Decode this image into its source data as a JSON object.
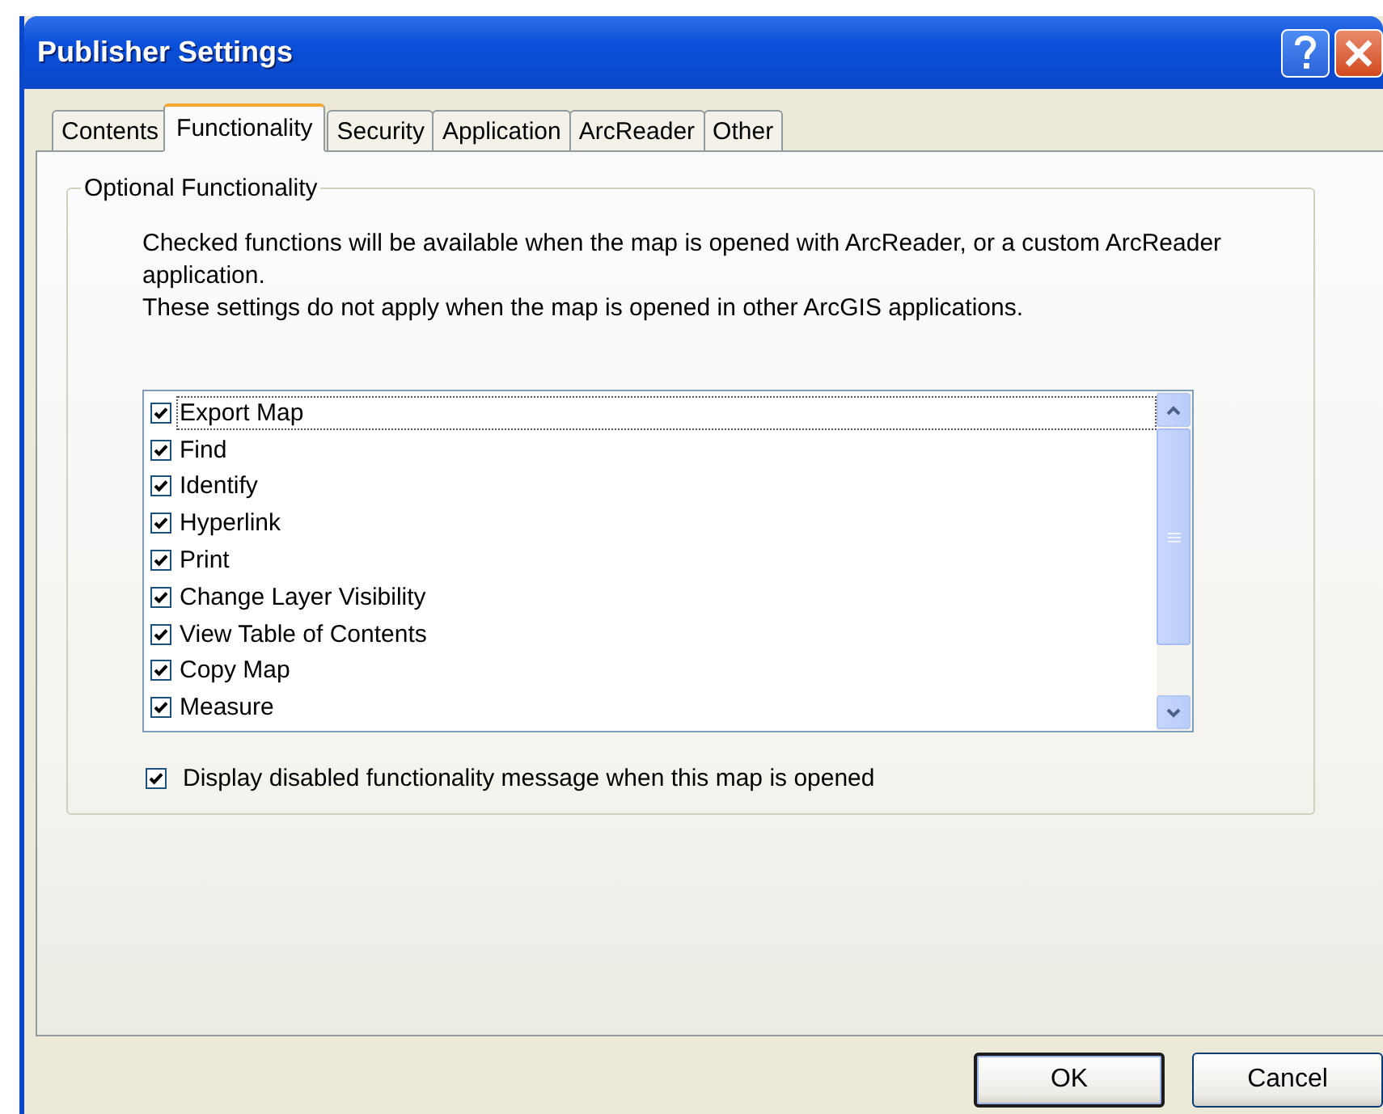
{
  "window": {
    "title": "Publisher Settings"
  },
  "tabs": [
    {
      "label": "Contents",
      "selected": false
    },
    {
      "label": "Functionality",
      "selected": true
    },
    {
      "label": "Security",
      "selected": false
    },
    {
      "label": "Application",
      "selected": false
    },
    {
      "label": "ArcReader",
      "selected": false
    },
    {
      "label": "Other",
      "selected": false
    }
  ],
  "group": {
    "title": "Optional Functionality",
    "description": [
      "Checked functions will be available when the map is opened with ArcReader, or a custom ArcReader application.",
      "These settings do not apply when the map is opened in other ArcGIS applications."
    ],
    "functions": [
      {
        "label": "Export Map",
        "checked": true,
        "focused": true
      },
      {
        "label": "Find",
        "checked": true,
        "focused": false
      },
      {
        "label": "Identify",
        "checked": true,
        "focused": false
      },
      {
        "label": "Hyperlink",
        "checked": true,
        "focused": false
      },
      {
        "label": "Print",
        "checked": true,
        "focused": false
      },
      {
        "label": "Change Layer Visibility",
        "checked": true,
        "focused": false
      },
      {
        "label": "View Table of Contents",
        "checked": true,
        "focused": false
      },
      {
        "label": "Copy Map",
        "checked": true,
        "focused": false
      },
      {
        "label": "Measure",
        "checked": true,
        "focused": false
      }
    ],
    "display_message": {
      "label": "Display disabled functionality message when this map is opened",
      "checked": true
    }
  },
  "buttons": [
    {
      "label": "OK",
      "default": true
    },
    {
      "label": "Cancel",
      "default": false
    }
  ]
}
